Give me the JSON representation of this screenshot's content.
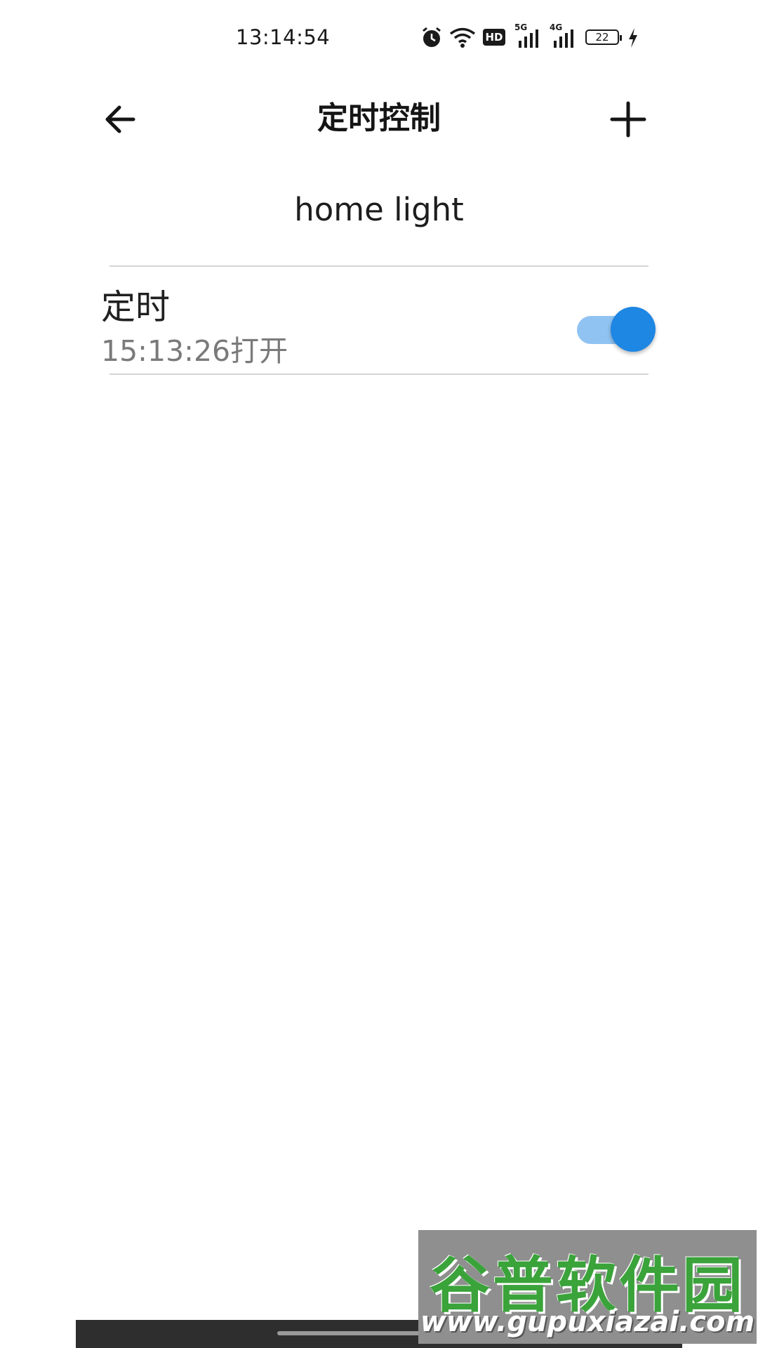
{
  "status_bar": {
    "time": "13:14:54",
    "icons": [
      "alarm-icon",
      "wifi-icon",
      "hd-icon",
      "signal-5g-icon",
      "signal-4g-icon",
      "battery-icon",
      "charging-icon"
    ],
    "signal_labels": [
      "5G",
      "4G"
    ],
    "hd_label": "HD",
    "battery": "22"
  },
  "app_bar": {
    "title": "定时控制"
  },
  "device": {
    "name": "home light"
  },
  "timers": [
    {
      "label": "定时",
      "time": "15:13:26打开",
      "enabled": true
    }
  ],
  "colors": {
    "switch_on_thumb": "#1e86e3",
    "switch_on_track": "#90c3f2"
  },
  "watermark": {
    "title": "谷普软件园",
    "url": "www.gupuxiazai.com"
  }
}
